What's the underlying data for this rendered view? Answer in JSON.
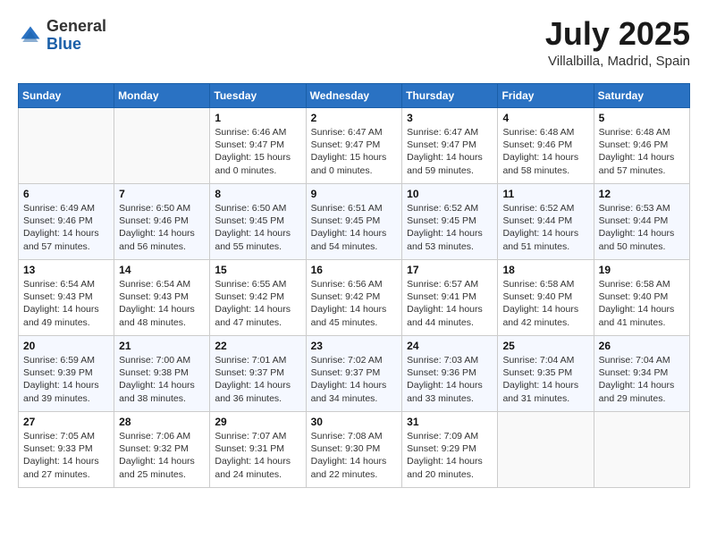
{
  "header": {
    "logo_general": "General",
    "logo_blue": "Blue",
    "month": "July 2025",
    "location": "Villalbilla, Madrid, Spain"
  },
  "days_of_week": [
    "Sunday",
    "Monday",
    "Tuesday",
    "Wednesday",
    "Thursday",
    "Friday",
    "Saturday"
  ],
  "weeks": [
    [
      {
        "day": "",
        "info": ""
      },
      {
        "day": "",
        "info": ""
      },
      {
        "day": "1",
        "info": "Sunrise: 6:46 AM\nSunset: 9:47 PM\nDaylight: 15 hours\nand 0 minutes."
      },
      {
        "day": "2",
        "info": "Sunrise: 6:47 AM\nSunset: 9:47 PM\nDaylight: 15 hours\nand 0 minutes."
      },
      {
        "day": "3",
        "info": "Sunrise: 6:47 AM\nSunset: 9:47 PM\nDaylight: 14 hours\nand 59 minutes."
      },
      {
        "day": "4",
        "info": "Sunrise: 6:48 AM\nSunset: 9:46 PM\nDaylight: 14 hours\nand 58 minutes."
      },
      {
        "day": "5",
        "info": "Sunrise: 6:48 AM\nSunset: 9:46 PM\nDaylight: 14 hours\nand 57 minutes."
      }
    ],
    [
      {
        "day": "6",
        "info": "Sunrise: 6:49 AM\nSunset: 9:46 PM\nDaylight: 14 hours\nand 57 minutes."
      },
      {
        "day": "7",
        "info": "Sunrise: 6:50 AM\nSunset: 9:46 PM\nDaylight: 14 hours\nand 56 minutes."
      },
      {
        "day": "8",
        "info": "Sunrise: 6:50 AM\nSunset: 9:45 PM\nDaylight: 14 hours\nand 55 minutes."
      },
      {
        "day": "9",
        "info": "Sunrise: 6:51 AM\nSunset: 9:45 PM\nDaylight: 14 hours\nand 54 minutes."
      },
      {
        "day": "10",
        "info": "Sunrise: 6:52 AM\nSunset: 9:45 PM\nDaylight: 14 hours\nand 53 minutes."
      },
      {
        "day": "11",
        "info": "Sunrise: 6:52 AM\nSunset: 9:44 PM\nDaylight: 14 hours\nand 51 minutes."
      },
      {
        "day": "12",
        "info": "Sunrise: 6:53 AM\nSunset: 9:44 PM\nDaylight: 14 hours\nand 50 minutes."
      }
    ],
    [
      {
        "day": "13",
        "info": "Sunrise: 6:54 AM\nSunset: 9:43 PM\nDaylight: 14 hours\nand 49 minutes."
      },
      {
        "day": "14",
        "info": "Sunrise: 6:54 AM\nSunset: 9:43 PM\nDaylight: 14 hours\nand 48 minutes."
      },
      {
        "day": "15",
        "info": "Sunrise: 6:55 AM\nSunset: 9:42 PM\nDaylight: 14 hours\nand 47 minutes."
      },
      {
        "day": "16",
        "info": "Sunrise: 6:56 AM\nSunset: 9:42 PM\nDaylight: 14 hours\nand 45 minutes."
      },
      {
        "day": "17",
        "info": "Sunrise: 6:57 AM\nSunset: 9:41 PM\nDaylight: 14 hours\nand 44 minutes."
      },
      {
        "day": "18",
        "info": "Sunrise: 6:58 AM\nSunset: 9:40 PM\nDaylight: 14 hours\nand 42 minutes."
      },
      {
        "day": "19",
        "info": "Sunrise: 6:58 AM\nSunset: 9:40 PM\nDaylight: 14 hours\nand 41 minutes."
      }
    ],
    [
      {
        "day": "20",
        "info": "Sunrise: 6:59 AM\nSunset: 9:39 PM\nDaylight: 14 hours\nand 39 minutes."
      },
      {
        "day": "21",
        "info": "Sunrise: 7:00 AM\nSunset: 9:38 PM\nDaylight: 14 hours\nand 38 minutes."
      },
      {
        "day": "22",
        "info": "Sunrise: 7:01 AM\nSunset: 9:37 PM\nDaylight: 14 hours\nand 36 minutes."
      },
      {
        "day": "23",
        "info": "Sunrise: 7:02 AM\nSunset: 9:37 PM\nDaylight: 14 hours\nand 34 minutes."
      },
      {
        "day": "24",
        "info": "Sunrise: 7:03 AM\nSunset: 9:36 PM\nDaylight: 14 hours\nand 33 minutes."
      },
      {
        "day": "25",
        "info": "Sunrise: 7:04 AM\nSunset: 9:35 PM\nDaylight: 14 hours\nand 31 minutes."
      },
      {
        "day": "26",
        "info": "Sunrise: 7:04 AM\nSunset: 9:34 PM\nDaylight: 14 hours\nand 29 minutes."
      }
    ],
    [
      {
        "day": "27",
        "info": "Sunrise: 7:05 AM\nSunset: 9:33 PM\nDaylight: 14 hours\nand 27 minutes."
      },
      {
        "day": "28",
        "info": "Sunrise: 7:06 AM\nSunset: 9:32 PM\nDaylight: 14 hours\nand 25 minutes."
      },
      {
        "day": "29",
        "info": "Sunrise: 7:07 AM\nSunset: 9:31 PM\nDaylight: 14 hours\nand 24 minutes."
      },
      {
        "day": "30",
        "info": "Sunrise: 7:08 AM\nSunset: 9:30 PM\nDaylight: 14 hours\nand 22 minutes."
      },
      {
        "day": "31",
        "info": "Sunrise: 7:09 AM\nSunset: 9:29 PM\nDaylight: 14 hours\nand 20 minutes."
      },
      {
        "day": "",
        "info": ""
      },
      {
        "day": "",
        "info": ""
      }
    ]
  ]
}
